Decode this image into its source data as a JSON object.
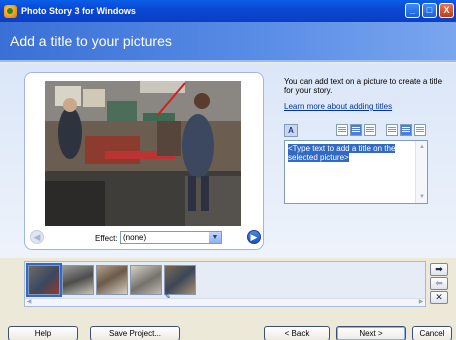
{
  "window": {
    "title": "Photo Story 3 for Windows",
    "buttons": [
      "minimize",
      "maximize",
      "close"
    ],
    "min_glyph": "_",
    "max_glyph": "□",
    "close_glyph": "X"
  },
  "header": {
    "title": "Add a title to your pictures"
  },
  "preview": {
    "effect_label": "Effect:",
    "effect_value": "(none)",
    "prev_glyph": "◀",
    "next_glyph": "▶"
  },
  "side_panel": {
    "info_text": "You can add text on a picture to create a title for your story.",
    "learn_more_link": "Learn more about adding titles",
    "title_text": "<Type text to add a title on the selected picture>"
  },
  "toolbar_icons": [
    "font-icon",
    "align-left-icon",
    "align-center-icon",
    "align-right-icon",
    "position-top-icon",
    "position-middle-icon",
    "position-bottom-icon"
  ],
  "filmstrip": {
    "thumbnails": 5,
    "selected_index": 0
  },
  "side_buttons": {
    "move_right": "➡",
    "move_left": "⬅",
    "remove": "✕"
  },
  "buttons": {
    "help": "Help",
    "save_project": "Save Project...",
    "back": "< Back",
    "next": "Next >",
    "cancel": "Cancel"
  },
  "colors": {
    "title_bar": "#0b48d4",
    "header": "#3a6fd6",
    "selection": "#316ac5"
  }
}
